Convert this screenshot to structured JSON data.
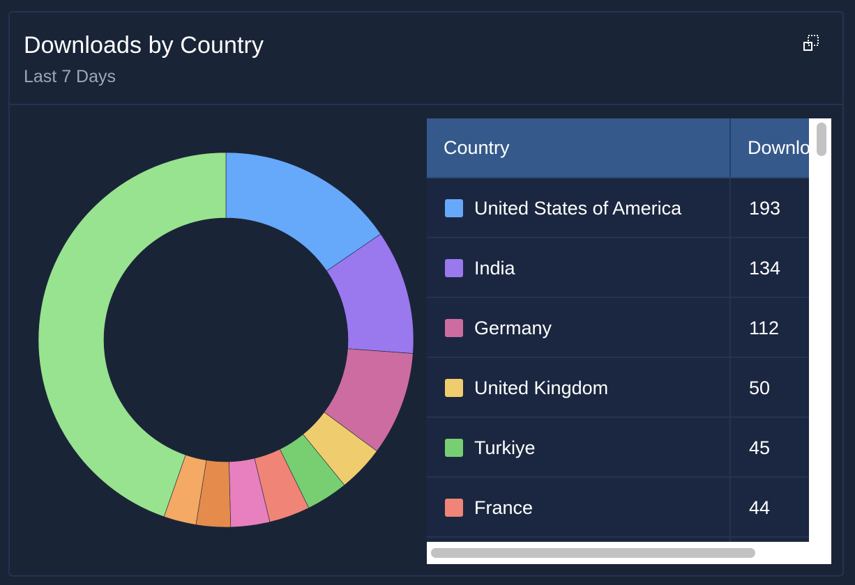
{
  "card": {
    "title": "Downloads by Country",
    "subtitle": "Last 7 Days",
    "expand_icon": "expand-icon"
  },
  "table": {
    "headers": [
      "Country",
      "Downlo"
    ],
    "rows": [
      {
        "country": "United States of America",
        "downloads": "193",
        "color": "#66a8fa"
      },
      {
        "country": "India",
        "downloads": "134",
        "color": "#9a78ee"
      },
      {
        "country": "Germany",
        "downloads": "112",
        "color": "#cd6ca0"
      },
      {
        "country": "United Kingdom",
        "downloads": "50",
        "color": "#efcd6e"
      },
      {
        "country": "Turkiye",
        "downloads": "45",
        "color": "#78cf72"
      },
      {
        "country": "France",
        "downloads": "44",
        "color": "#f08577"
      }
    ]
  },
  "colors": {
    "background": "#1a2437",
    "header_row": "#35598a"
  },
  "chart_data": {
    "type": "pie",
    "slices": [
      {
        "name": "United States of America",
        "value": 193,
        "color": "#66a8fa"
      },
      {
        "name": "India",
        "value": 134,
        "color": "#9a78ee"
      },
      {
        "name": "Germany",
        "value": 112,
        "color": "#cd6ca0"
      },
      {
        "name": "United Kingdom",
        "value": 50,
        "color": "#efcd6e"
      },
      {
        "name": "Turkiye",
        "value": 45,
        "color": "#78cf72"
      },
      {
        "name": "France",
        "value": 44,
        "color": "#f08577"
      },
      {
        "value": 42,
        "color": "#e87fbe"
      },
      {
        "value": 37,
        "color": "#e58b4c"
      },
      {
        "value": 35,
        "color": "#f4a964"
      },
      {
        "value": 558,
        "color": "#98e38f"
      }
    ]
  }
}
